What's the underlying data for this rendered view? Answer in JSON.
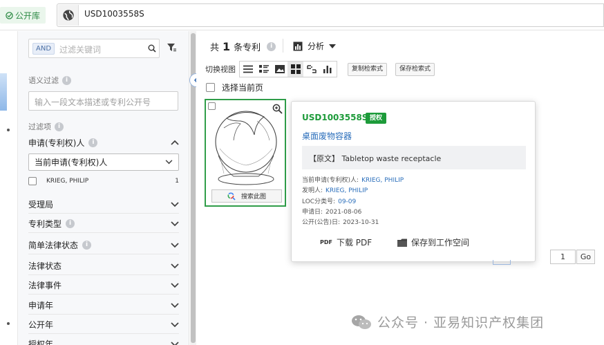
{
  "top": {
    "library_label": "公开库",
    "query": "USD1003558S"
  },
  "filter": {
    "and_label": "AND",
    "keyword_placeholder": "过滤关键词",
    "semantic_label": "语义过滤",
    "semantic_placeholder": "输入一段文本描述或专利公开号",
    "filter_items_label": "过滤项",
    "applicant_label": "申请(专利权)人",
    "applicant_select": "当前申请(专利权)人",
    "applicant_value": "KRIEG, PHILIP",
    "applicant_count": "1",
    "facets": [
      "受理局",
      "专利类型",
      "简单法律状态",
      "法律状态",
      "法律事件",
      "申请年",
      "公开年",
      "授权年"
    ]
  },
  "results": {
    "count_prefix": "共",
    "count_value": "1",
    "count_suffix": "条专利",
    "analysis_label": "分析",
    "view_label": "切换视图",
    "copy_query": "复制检索式",
    "save_query": "保存检索式",
    "select_page": "选择当前页",
    "search_image": "搜索此图"
  },
  "popup": {
    "pub_no": "USD1003558S1",
    "status_badge": "授权",
    "title": "桌面废物容器",
    "original_prefix": "【原文】",
    "original_title": "Tabletop waste receptacle",
    "current_applicant_label": "当前申请(专利权)人:",
    "current_applicant": "KRIEG, PHILIP",
    "inventor_label": "发明人:",
    "inventor": "KRIEG, PHILIP",
    "loc_label": "LOC分类号:",
    "loc": "09-09",
    "apply_date_label": "申请日:",
    "apply_date": "2021-08-06",
    "pub_date_label": "公开(公告)日:",
    "pub_date": "2023-10-31",
    "download_pdf": "下载 PDF",
    "pdf_tag": "PDF",
    "save_workspace": "保存到工作空间"
  },
  "pager": {
    "page": "1",
    "go": "Go"
  },
  "watermark": "公众号 · 亚易知识产权集团",
  "colors": {
    "accent_green": "#1d9b3a",
    "link_blue": "#2a6ebb"
  }
}
